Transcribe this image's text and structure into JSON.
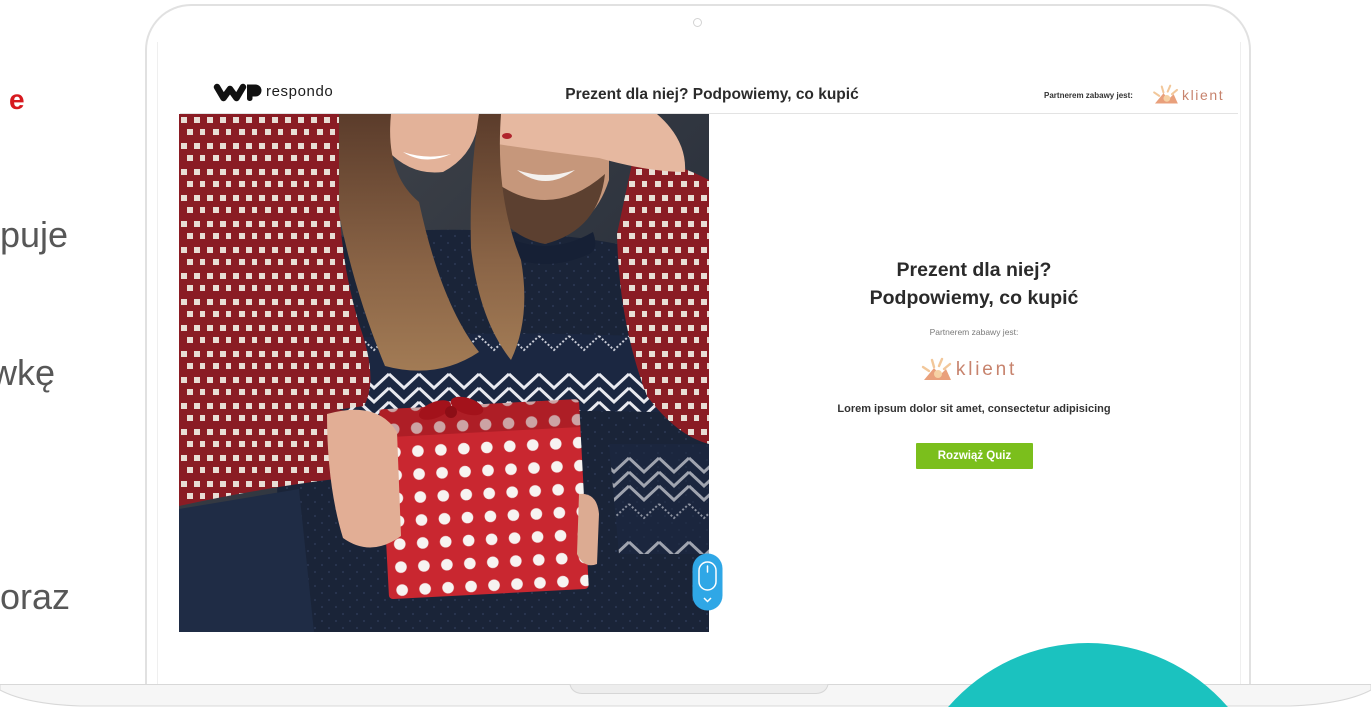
{
  "background_copy": {
    "fragment_1": "e",
    "fragment_2": "puje",
    "fragment_3": "wkę",
    "fragment_4": "oraz"
  },
  "header": {
    "brand_name": "respondo",
    "title": "Prezent dla niej? Podpowiemy, co kupić",
    "partner_label": "Partnerem zabawy jest:",
    "partner_name": "klient"
  },
  "intro": {
    "title_line_1": "Prezent dla niej?",
    "title_line_2": "Podpowiemy, co kupić",
    "partner_label": "Partnerem zabawy jest:",
    "partner_name": "klient",
    "description": "Lorem ipsum dolor sit amet, consectetur adipisicing",
    "cta_label": "Rozwiąż Quiz"
  },
  "icons": {
    "brand_logo": "wp-logo-icon",
    "partner_logo": "klient-logo-icon",
    "scroll_hint": "scroll-mouse-icon",
    "camera": "camera-dot-icon"
  },
  "colors": {
    "brand_red": "#d7191f",
    "cta_green": "#7bbf1c",
    "teal_circle": "#1bc2bf",
    "scroll_blue": "#2fa7e6",
    "partner_brand": "#c7836d"
  }
}
